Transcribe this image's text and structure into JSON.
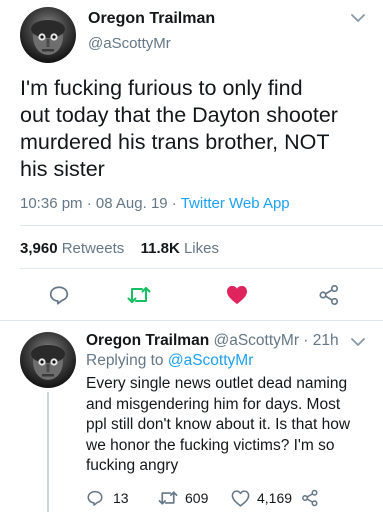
{
  "tweet": {
    "author_name": "Oregon Trailman",
    "author_handle": "@aScottyMr",
    "text_lines": [
      "I'm fucking furious to only find",
      "out today that the Dayton shooter",
      "murdered his trans brother, NOT",
      "his sister"
    ],
    "time": "10:36 pm",
    "separator": "·",
    "date": "08 Aug. 19",
    "client": "Twitter Web App",
    "retweets_count": "3,960",
    "retweets_label": "Retweets",
    "likes_count": "11.8K",
    "likes_label": "Likes"
  },
  "reply": {
    "author_name": "Oregon Trailman",
    "author_handle": "@aScottyMr",
    "age": "21h",
    "replying_prefix": "Replying to",
    "replying_handle": "@aScottyMr",
    "text_lines": [
      "Every single news outlet dead naming",
      "and misgendering him for days. Most",
      "ppl still don't know about it. Is that how",
      "we honor the fucking victims? I'm so",
      "fucking angry"
    ],
    "reply_count": "13",
    "retweet_count": "609",
    "like_count": "4,169"
  },
  "colors": {
    "accent": "#1da1f2",
    "retweet": "#17bf63",
    "like": "#e0245e",
    "muted": "#657786"
  },
  "icons": [
    "chevron-down-icon",
    "reply-icon",
    "retweet-icon",
    "heart-icon",
    "share-icon"
  ]
}
